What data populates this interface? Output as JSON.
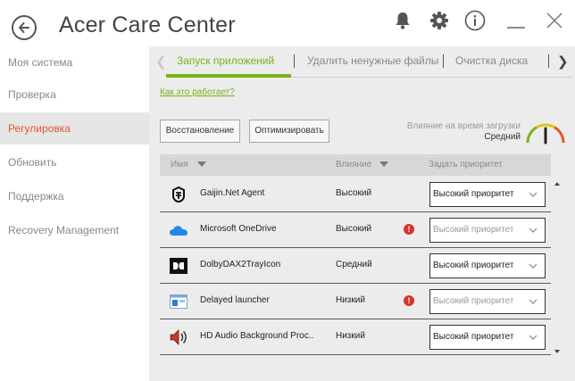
{
  "window": {
    "title": "Acer Care Center"
  },
  "sidebar": {
    "items": [
      {
        "label": "Моя система",
        "active": false
      },
      {
        "label": "Проверка",
        "active": false
      },
      {
        "label": "Регулировка",
        "active": true
      },
      {
        "label": "Обновить",
        "active": false
      },
      {
        "label": "Поддержка",
        "active": false
      },
      {
        "label": "Recovery Management",
        "active": false
      }
    ]
  },
  "tabs": [
    {
      "label": "Запуск приложений",
      "active": true
    },
    {
      "label": "Удалить ненужные файлы",
      "active": false
    },
    {
      "label": "Очистка диска",
      "active": false
    }
  ],
  "main": {
    "how_link": "Как это работает?",
    "restore_button": "Восстановление",
    "optimize_button": "Оптимизировать",
    "impact_label": "Влияние на время загрузки",
    "impact_value": "Средний",
    "impact_level": 0.5
  },
  "table": {
    "headers": {
      "name": "Имя",
      "impact": "Влияние",
      "priority": "Задать приоритет"
    },
    "rows": [
      {
        "name": "Gaijin.Net Agent",
        "impact": "Высокий",
        "warning": false,
        "priority": "Высокий приоритет",
        "icon": "gaijin-icon"
      },
      {
        "name": "Microsoft OneDrive",
        "impact": "Высокий",
        "warning": true,
        "priority": "Высокий приоритет",
        "icon": "onedrive-icon"
      },
      {
        "name": "DolbyDAX2TrayIcon",
        "impact": "Средний",
        "warning": false,
        "priority": "Высокий приоритет",
        "icon": "dolby-icon"
      },
      {
        "name": "Delayed launcher",
        "impact": "Низкий",
        "warning": true,
        "priority": "Высокий приоритет",
        "icon": "delayed-launcher-icon"
      },
      {
        "name": "HD Audio Background Proc..",
        "impact": "Низкий",
        "warning": false,
        "priority": "Высокий приоритет",
        "icon": "speaker-icon"
      }
    ]
  },
  "colors": {
    "accent": "#7ab317",
    "active_nav": "#e8552b",
    "warning": "#d9342b"
  },
  "icons": [
    "back-arrow-icon",
    "bell-icon",
    "gear-icon",
    "info-icon",
    "minimize-icon",
    "close-icon"
  ]
}
